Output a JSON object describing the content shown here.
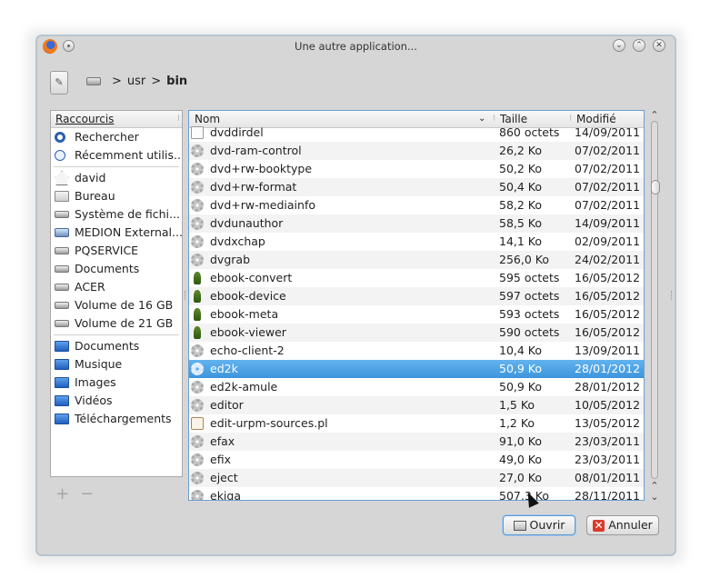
{
  "window": {
    "title": "Une autre application..."
  },
  "breadcrumb": {
    "segments": [
      "usr",
      "bin"
    ],
    "separator": ">"
  },
  "places": {
    "header": "Raccourcis",
    "items": [
      {
        "label": "Rechercher",
        "icon": "search-icon"
      },
      {
        "label": "Récemment utilis...",
        "icon": "clock-icon"
      },
      {
        "label": "david",
        "icon": "home-icon"
      },
      {
        "label": "Bureau",
        "icon": "folder-icon"
      },
      {
        "label": "Système de fichi...",
        "icon": "drive-icon"
      },
      {
        "label": "MEDION External...",
        "icon": "media-icon"
      },
      {
        "label": "PQSERVICE",
        "icon": "drive-icon"
      },
      {
        "label": "Documents",
        "icon": "drive-icon"
      },
      {
        "label": "ACER",
        "icon": "drive-icon"
      },
      {
        "label": "Volume de 16 GB",
        "icon": "drive-icon"
      },
      {
        "label": "Volume de 21 GB",
        "icon": "drive-icon"
      },
      {
        "label": "Documents",
        "icon": "folder-icon"
      },
      {
        "label": "Musique",
        "icon": "folder-icon"
      },
      {
        "label": "Images",
        "icon": "folder-icon"
      },
      {
        "label": "Vidéos",
        "icon": "folder-icon"
      },
      {
        "label": "Téléchargements",
        "icon": "folder-icon"
      }
    ],
    "add_symbol": "+",
    "remove_symbol": "−"
  },
  "files": {
    "columns": {
      "name": "Nom",
      "size": "Taille",
      "modified": "Modifié"
    },
    "rows": [
      {
        "name": "dvddirdel",
        "size": "860 octets",
        "date": "14/09/2011",
        "icon": "script-icon"
      },
      {
        "name": "dvd-ram-control",
        "size": "26,2 Ko",
        "date": "07/02/2011",
        "icon": "gear-icon"
      },
      {
        "name": "dvd+rw-booktype",
        "size": "50,2 Ko",
        "date": "07/02/2011",
        "icon": "gear-icon"
      },
      {
        "name": "dvd+rw-format",
        "size": "50,4 Ko",
        "date": "07/02/2011",
        "icon": "gear-icon"
      },
      {
        "name": "dvd+rw-mediainfo",
        "size": "58,2 Ko",
        "date": "07/02/2011",
        "icon": "gear-icon"
      },
      {
        "name": "dvdunauthor",
        "size": "58,5 Ko",
        "date": "14/09/2011",
        "icon": "gear-icon"
      },
      {
        "name": "dvdxchap",
        "size": "14,1 Ko",
        "date": "02/09/2011",
        "icon": "gear-icon"
      },
      {
        "name": "dvgrab",
        "size": "256,0 Ko",
        "date": "24/02/2011",
        "icon": "gear-icon"
      },
      {
        "name": "ebook-convert",
        "size": "595 octets",
        "date": "16/05/2012",
        "icon": "python-icon"
      },
      {
        "name": "ebook-device",
        "size": "597 octets",
        "date": "16/05/2012",
        "icon": "python-icon"
      },
      {
        "name": "ebook-meta",
        "size": "593 octets",
        "date": "16/05/2012",
        "icon": "python-icon"
      },
      {
        "name": "ebook-viewer",
        "size": "590 octets",
        "date": "16/05/2012",
        "icon": "python-icon"
      },
      {
        "name": "echo-client-2",
        "size": "10,4 Ko",
        "date": "13/09/2011",
        "icon": "gear-icon"
      },
      {
        "name": "ed2k",
        "size": "50,9 Ko",
        "date": "28/01/2012",
        "icon": "gear-icon",
        "selected": true
      },
      {
        "name": "ed2k-amule",
        "size": "50,9 Ko",
        "date": "28/01/2012",
        "icon": "gear-icon"
      },
      {
        "name": "editor",
        "size": "1,5 Ko",
        "date": "10/05/2012",
        "icon": "gear-icon"
      },
      {
        "name": "edit-urpm-sources.pl",
        "size": "1,2 Ko",
        "date": "13/05/2012",
        "icon": "perl-icon"
      },
      {
        "name": "efax",
        "size": "91,0 Ko",
        "date": "23/03/2011",
        "icon": "gear-icon"
      },
      {
        "name": "efix",
        "size": "49,0 Ko",
        "date": "23/03/2011",
        "icon": "gear-icon"
      },
      {
        "name": "eject",
        "size": "27,0 Ko",
        "date": "08/01/2011",
        "icon": "gear-icon"
      },
      {
        "name": "ekiga",
        "size": "507,3 Ko",
        "date": "28/11/2011",
        "icon": "gear-icon"
      }
    ]
  },
  "buttons": {
    "open": "Ouvrir",
    "cancel": "Annuler"
  }
}
